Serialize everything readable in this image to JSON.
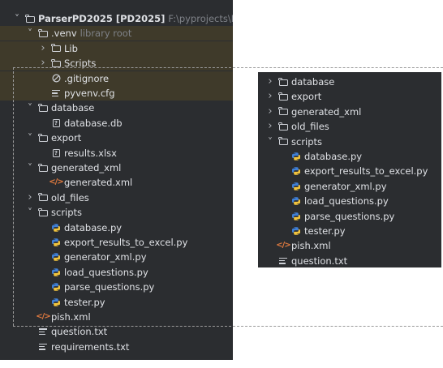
{
  "left_panel": {
    "rows": [
      {
        "label": "ParserPD2025",
        "extra": "[PD2025]",
        "dim": "F:\\pyprojects\\Parser",
        "icon": "folder-icon",
        "arrow": "expanded",
        "depth": 0,
        "highlight": false
      },
      {
        "label": ".venv",
        "extra": "",
        "dim": "library root",
        "icon": "folder-icon",
        "arrow": "expanded",
        "depth": 1,
        "highlight": true
      },
      {
        "label": "Lib",
        "extra": "",
        "dim": "",
        "icon": "folder-icon",
        "arrow": "collapsed",
        "depth": 2,
        "highlight": true
      },
      {
        "label": "Scripts",
        "extra": "",
        "dim": "",
        "icon": "folder-icon",
        "arrow": "collapsed",
        "depth": 2,
        "highlight": true
      },
      {
        "label": ".gitignore",
        "extra": "",
        "dim": "",
        "icon": "gitignore-icon",
        "arrow": "none",
        "depth": 2,
        "highlight": true
      },
      {
        "label": "pyvenv.cfg",
        "extra": "",
        "dim": "",
        "icon": "text-file-icon",
        "arrow": "none",
        "depth": 2,
        "highlight": true
      },
      {
        "label": "database",
        "extra": "",
        "dim": "",
        "icon": "folder-icon",
        "arrow": "expanded",
        "depth": 1,
        "highlight": false
      },
      {
        "label": "database.db",
        "extra": "",
        "dim": "",
        "icon": "unknown-file-icon",
        "arrow": "none",
        "depth": 2,
        "highlight": false
      },
      {
        "label": "export",
        "extra": "",
        "dim": "",
        "icon": "folder-icon",
        "arrow": "expanded",
        "depth": 1,
        "highlight": false
      },
      {
        "label": "results.xlsx",
        "extra": "",
        "dim": "",
        "icon": "unknown-file-icon",
        "arrow": "none",
        "depth": 2,
        "highlight": false
      },
      {
        "label": "generated_xml",
        "extra": "",
        "dim": "",
        "icon": "folder-icon",
        "arrow": "expanded",
        "depth": 1,
        "highlight": false
      },
      {
        "label": "generated.xml",
        "extra": "",
        "dim": "",
        "icon": "xml-file-icon",
        "arrow": "none",
        "depth": 2,
        "highlight": false
      },
      {
        "label": "old_files",
        "extra": "",
        "dim": "",
        "icon": "folder-icon",
        "arrow": "collapsed",
        "depth": 1,
        "highlight": false
      },
      {
        "label": "scripts",
        "extra": "",
        "dim": "",
        "icon": "folder-icon",
        "arrow": "expanded",
        "depth": 1,
        "highlight": false
      },
      {
        "label": "database.py",
        "extra": "",
        "dim": "",
        "icon": "python-file-icon",
        "arrow": "none",
        "depth": 2,
        "highlight": false
      },
      {
        "label": "export_results_to_excel.py",
        "extra": "",
        "dim": "",
        "icon": "python-file-icon",
        "arrow": "none",
        "depth": 2,
        "highlight": false
      },
      {
        "label": "generator_xml.py",
        "extra": "",
        "dim": "",
        "icon": "python-file-icon",
        "arrow": "none",
        "depth": 2,
        "highlight": false
      },
      {
        "label": "load_questions.py",
        "extra": "",
        "dim": "",
        "icon": "python-file-icon",
        "arrow": "none",
        "depth": 2,
        "highlight": false
      },
      {
        "label": "parse_questions.py",
        "extra": "",
        "dim": "",
        "icon": "python-file-icon",
        "arrow": "none",
        "depth": 2,
        "highlight": false
      },
      {
        "label": "tester.py",
        "extra": "",
        "dim": "",
        "icon": "python-file-icon",
        "arrow": "none",
        "depth": 2,
        "highlight": false
      },
      {
        "label": "pish.xml",
        "extra": "",
        "dim": "",
        "icon": "xml-file-icon",
        "arrow": "none",
        "depth": 1,
        "highlight": false
      },
      {
        "label": "question.txt",
        "extra": "",
        "dim": "",
        "icon": "text-file-icon",
        "arrow": "none",
        "depth": 1,
        "highlight": false
      },
      {
        "label": "requirements.txt",
        "extra": "",
        "dim": "",
        "icon": "text-file-icon",
        "arrow": "none",
        "depth": 1,
        "highlight": false
      }
    ]
  },
  "right_panel": {
    "rows": [
      {
        "label": "database",
        "icon": "folder-icon",
        "arrow": "collapsed",
        "depth": 0
      },
      {
        "label": "export",
        "icon": "folder-icon",
        "arrow": "collapsed",
        "depth": 0
      },
      {
        "label": "generated_xml",
        "icon": "folder-icon",
        "arrow": "collapsed",
        "depth": 0
      },
      {
        "label": "old_files",
        "icon": "folder-icon",
        "arrow": "collapsed",
        "depth": 0
      },
      {
        "label": "scripts",
        "icon": "folder-icon",
        "arrow": "expanded",
        "depth": 0
      },
      {
        "label": "database.py",
        "icon": "python-file-icon",
        "arrow": "none",
        "depth": 1
      },
      {
        "label": "export_results_to_excel.py",
        "icon": "python-file-icon",
        "arrow": "none",
        "depth": 1
      },
      {
        "label": "generator_xml.py",
        "icon": "python-file-icon",
        "arrow": "none",
        "depth": 1
      },
      {
        "label": "load_questions.py",
        "icon": "python-file-icon",
        "arrow": "none",
        "depth": 1
      },
      {
        "label": "parse_questions.py",
        "icon": "python-file-icon",
        "arrow": "none",
        "depth": 1
      },
      {
        "label": "tester.py",
        "icon": "python-file-icon",
        "arrow": "none",
        "depth": 1
      },
      {
        "label": "pish.xml",
        "icon": "xml-file-icon",
        "arrow": "none",
        "depth": 0
      },
      {
        "label": "question.txt",
        "icon": "text-file-icon",
        "arrow": "none",
        "depth": 0
      }
    ]
  },
  "colors": {
    "panel_bg": "#2b2d30",
    "highlight_bg": "#3f3a2a",
    "text": "#dfe1e5",
    "dim_text": "#7f8288",
    "python_blue": "#3f7fd6",
    "python_yellow": "#f2c43d",
    "xml_orange": "#e07a3f"
  }
}
